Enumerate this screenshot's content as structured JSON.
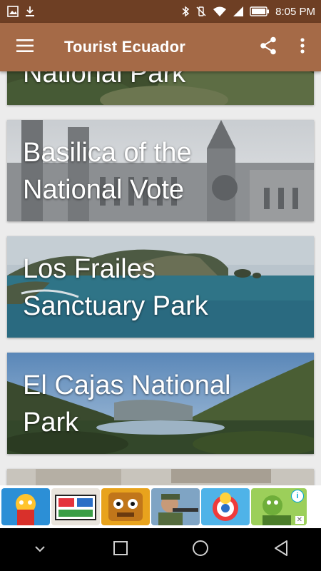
{
  "status_bar": {
    "time": "8:05 PM"
  },
  "app_bar": {
    "title": "Tourist Ecuador",
    "menu_icon": "hamburger-menu-icon",
    "share_icon": "share-icon",
    "more_icon": "more-vert-icon"
  },
  "places": [
    {
      "title": "National Park"
    },
    {
      "title": "Basilica of the\nNational Vote"
    },
    {
      "title": "Los Frailes\nSanctuary Park"
    },
    {
      "title": "El Cajas National\nPark"
    }
  ],
  "ad": {
    "info_label": "i",
    "close_label": "✕",
    "games": [
      "game-ad-1",
      "game-ad-2",
      "game-ad-3",
      "game-ad-4",
      "game-ad-5",
      "game-ad-6"
    ]
  },
  "colors": {
    "status_bar": "#6e3f24",
    "app_bar": "#a56a47",
    "background": "#ececec"
  }
}
